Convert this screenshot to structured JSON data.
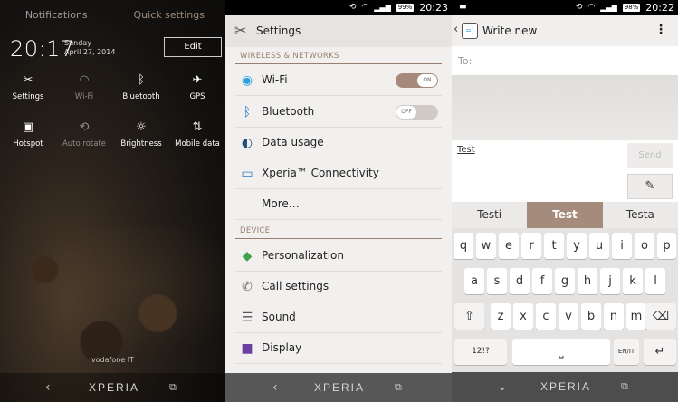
{
  "panel_quick": {
    "tabs": [
      "Notifications",
      "Quick settings"
    ],
    "time": "20:17",
    "day": "Sunday",
    "date": "April 27, 2014",
    "edit_label": "Edit",
    "tiles": [
      {
        "label": "Settings",
        "icon": "wrench-icon",
        "glyph": "✂"
      },
      {
        "label": "Wi-Fi",
        "icon": "wifi-icon",
        "glyph": "◠"
      },
      {
        "label": "Bluetooth",
        "icon": "bluetooth-icon",
        "glyph": "ᛒ"
      },
      {
        "label": "GPS",
        "icon": "gps-icon",
        "glyph": "✈"
      },
      {
        "label": "Hotspot",
        "icon": "hotspot-icon",
        "glyph": "▣"
      },
      {
        "label": "Auto rotate",
        "icon": "rotate-icon",
        "glyph": "⟲"
      },
      {
        "label": "Brightness",
        "icon": "brightness-icon",
        "glyph": "☼"
      },
      {
        "label": "Mobile data",
        "icon": "mobile-data-icon",
        "glyph": "⇅"
      }
    ],
    "carrier": "vodafone IT",
    "nav_brand": "XPERIA"
  },
  "panel_settings": {
    "status_time": "20:23",
    "battery": "99%",
    "title": "Settings",
    "section_wireless": "WIRELESS & NETWORKS",
    "section_device": "DEVICE",
    "rows_wireless": [
      {
        "label": "Wi-Fi",
        "icon": "wifi-icon",
        "glyph": "◉",
        "color": "#2a9ee0"
      },
      {
        "label": "Bluetooth",
        "icon": "bluetooth-icon",
        "glyph": "ᛒ",
        "color": "#1a75c9"
      },
      {
        "label": "Data usage",
        "icon": "data-usage-icon",
        "glyph": "◐",
        "color": "#1e4f7a"
      },
      {
        "label": "Xperia™ Connectivity",
        "icon": "connectivity-icon",
        "glyph": "▭",
        "color": "#2e7fc1"
      },
      {
        "label": "More…",
        "icon": "",
        "glyph": "",
        "color": ""
      }
    ],
    "toggle_on": "ON",
    "toggle_off": "OFF",
    "rows_device": [
      {
        "label": "Personalization",
        "icon": "personalization-icon",
        "glyph": "◆",
        "color": "#3fa14a"
      },
      {
        "label": "Call settings",
        "icon": "phone-icon",
        "glyph": "✆",
        "color": "#777"
      },
      {
        "label": "Sound",
        "icon": "sound-icon",
        "glyph": "☰",
        "color": "#555"
      },
      {
        "label": "Display",
        "icon": "display-icon",
        "glyph": "■",
        "color": "#6a3fa0"
      }
    ],
    "nav_brand": "XPERIA"
  },
  "panel_messaging": {
    "status_time": "20:22",
    "battery": "98%",
    "title": "Write new",
    "to_placeholder": "To:",
    "compose_text": "Test",
    "send_label": "Send",
    "suggestions": [
      "Testi",
      "Test",
      "Testa"
    ],
    "row1": [
      "q",
      "w",
      "e",
      "r",
      "t",
      "y",
      "u",
      "i",
      "o",
      "p"
    ],
    "row2": [
      "a",
      "s",
      "d",
      "f",
      "g",
      "h",
      "j",
      "k",
      "l"
    ],
    "row3": [
      "z",
      "x",
      "c",
      "v",
      "b",
      "n",
      "m"
    ],
    "shift_glyph": "⇧",
    "backspace_glyph": "⌫",
    "symbols_label": "12!?",
    "lang_label": "EN/IT",
    "enter_glyph": "↵",
    "nav_brand": "XPERIA"
  }
}
